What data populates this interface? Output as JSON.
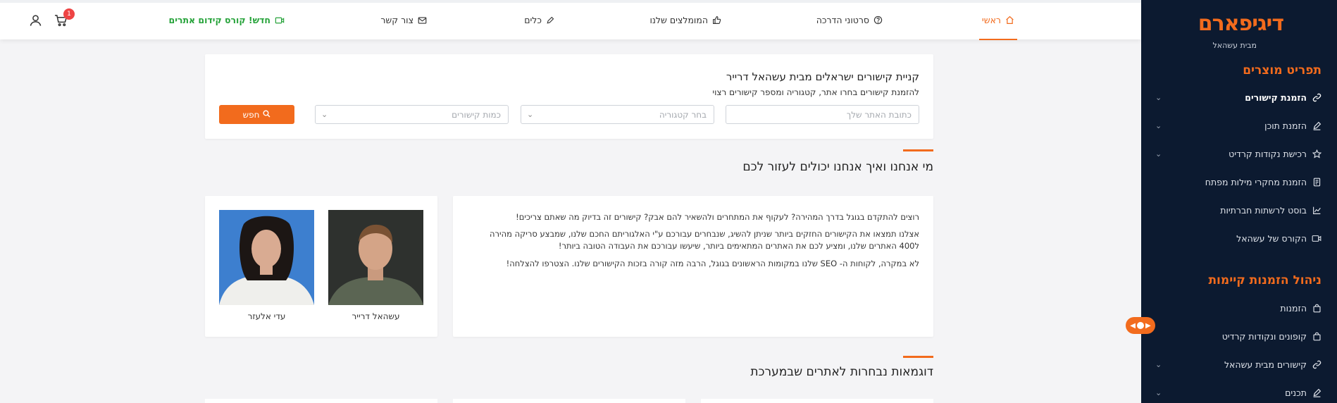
{
  "brand": {
    "logo_word": "דיגיפארם",
    "logo_sub": "מבית עשהאל"
  },
  "sidebar": {
    "section1_title": "תפריט מוצרים",
    "section1_items": [
      {
        "label": "הזמנת קישורים",
        "icon": "link-icon",
        "active": true,
        "has_chevron": true
      },
      {
        "label": "הזמנת תוכן",
        "icon": "pencil-icon",
        "active": false,
        "has_chevron": true
      },
      {
        "label": "רכישת נקודות קרדיט",
        "icon": "star-icon",
        "active": false,
        "has_chevron": true
      },
      {
        "label": "הזמנת מחקרי מילות מפתח",
        "icon": "document-icon",
        "active": false,
        "has_chevron": false
      },
      {
        "label": "בוסט לרשתות חברתיות",
        "icon": "chart-icon",
        "active": false,
        "has_chevron": false
      },
      {
        "label": "הקורס של עשהאל",
        "icon": "video-icon",
        "active": false,
        "has_chevron": false
      }
    ],
    "section2_title": "ניהול הזמנות קיימות",
    "section2_items": [
      {
        "label": "הזמנות",
        "icon": "bag-icon",
        "active": false,
        "has_chevron": false
      },
      {
        "label": "קופונים ונקודות קרדיט",
        "icon": "bag-icon",
        "active": false,
        "has_chevron": false
      },
      {
        "label": "קישורים מבית עשהאל",
        "icon": "link-icon",
        "active": false,
        "has_chevron": true
      },
      {
        "label": "תכנים",
        "icon": "pencil-icon",
        "active": false,
        "has_chevron": true
      }
    ]
  },
  "topnav": {
    "home": "ראשי",
    "tutorials": "סרטוני הדרכה",
    "recommended": "המומלצים שלנו",
    "tools": "כלים",
    "contact": "צור קשר",
    "promo": "חדש! קורס קידום אתרים",
    "cart_count": "1"
  },
  "search": {
    "title": "קניית קישורים ישראלים מבית עשהאל דרייר",
    "subtitle": "להזמנת קישורים בחרו אתר, קטגוריה ומספר קישורים רצוי",
    "site_placeholder": "כתובת האתר שלך",
    "category_placeholder": "בחר קטגוריה",
    "count_placeholder": "כמות קישורים",
    "button_label": "חפש"
  },
  "about": {
    "heading": "מי אנחנו ואיך אנחנו יכולים לעזור לכם",
    "p1": "רוצים להתקדם בגוגל בדרך המהירה? לעקוף את המתחרים ולהשאיר להם אבק? קישורים זה בדיוק מה שאתם צריכים!",
    "p2": "אצלנו תמצאו את הקישורים החזקים ביותר שניתן להשיג, שנבחרים עבורכם ע\"י האלגוריתם החכם שלנו, שמבצע סריקה מהירה ל400 האתרים שלנו, ומציע לכם את האתרים המתאימים ביותר, שיעשו עבורכם את העבודה הטובה ביותר!",
    "p3": "לא במקרה, לקוחות ה- SEO שלנו במקומות הראשונים בגוגל, הרבה מזה קורה בזכות הקישורים שלנו. הצטרפו להצלחה!"
  },
  "team": [
    {
      "name": "עשהאל דרייר"
    },
    {
      "name": "עדי אלעזר"
    }
  ],
  "examples": {
    "heading": "דוגמאות נבחרות לאתרים שבמערכת"
  },
  "colors": {
    "accent": "#f26b1d",
    "sidebar_bg": "#0c1a30",
    "promo_green": "#27a33b",
    "badge_red": "#ee4444"
  }
}
